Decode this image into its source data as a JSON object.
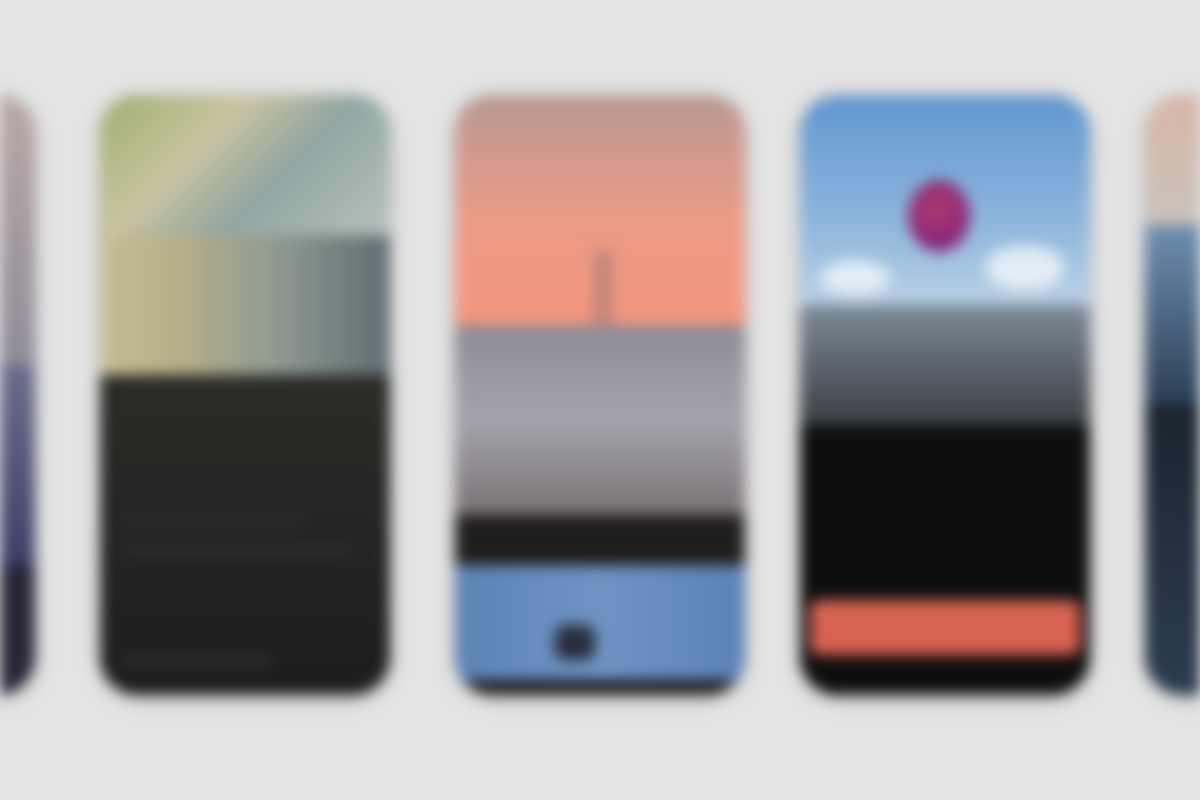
{
  "screens": [
    {
      "id": "left-partial",
      "theme": "lavender"
    },
    {
      "id": "garden",
      "theme": "green-dark"
    },
    {
      "id": "sunset",
      "theme": "coral-blue"
    },
    {
      "id": "balloon",
      "theme": "sky-dark",
      "cta_color": "#d76352"
    },
    {
      "id": "right-partial",
      "theme": "peach-blue"
    }
  ],
  "colors": {
    "background": "#e4e4e4",
    "accent": "#d76352"
  }
}
